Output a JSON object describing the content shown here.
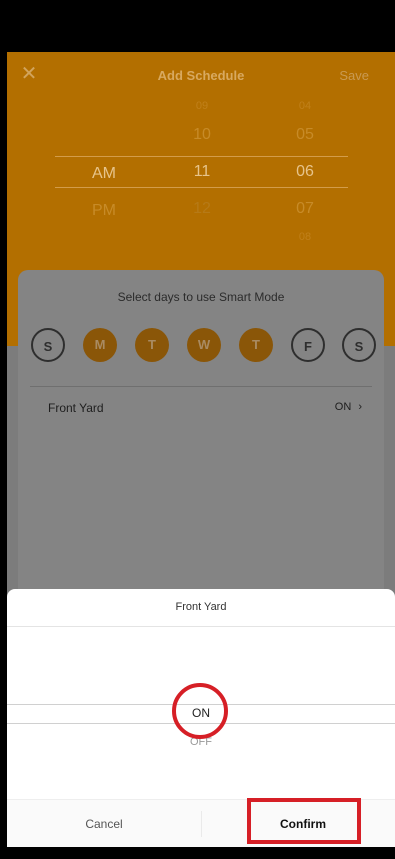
{
  "header": {
    "close_icon": "close-icon",
    "title": "Add Schedule",
    "save_label": "Save"
  },
  "time_picker": {
    "ampm": [
      "",
      "AM",
      "PM"
    ],
    "hours": [
      "09",
      "10",
      "11",
      "12"
    ],
    "minutes": [
      "04",
      "05",
      "06",
      "07",
      "08"
    ],
    "selected": {
      "ampm": "AM",
      "hour": "11",
      "minute": "06"
    }
  },
  "card": {
    "caption": "Select days to use Smart Mode",
    "days": [
      {
        "label": "S",
        "active": false
      },
      {
        "label": "M",
        "active": true
      },
      {
        "label": "T",
        "active": true
      },
      {
        "label": "W",
        "active": true
      },
      {
        "label": "T",
        "active": true
      },
      {
        "label": "F",
        "active": false
      },
      {
        "label": "S",
        "active": false
      }
    ],
    "zone_label": "Front Yard",
    "zone_value": "ON",
    "chevron_icon": "chevron-right-icon"
  },
  "sheet": {
    "title": "Front Yard",
    "option_on": "ON",
    "option_off": "OFF",
    "cancel_label": "Cancel",
    "confirm_label": "Confirm"
  },
  "colors": {
    "accent": "#B36F00",
    "highlight": "#d61f26"
  }
}
